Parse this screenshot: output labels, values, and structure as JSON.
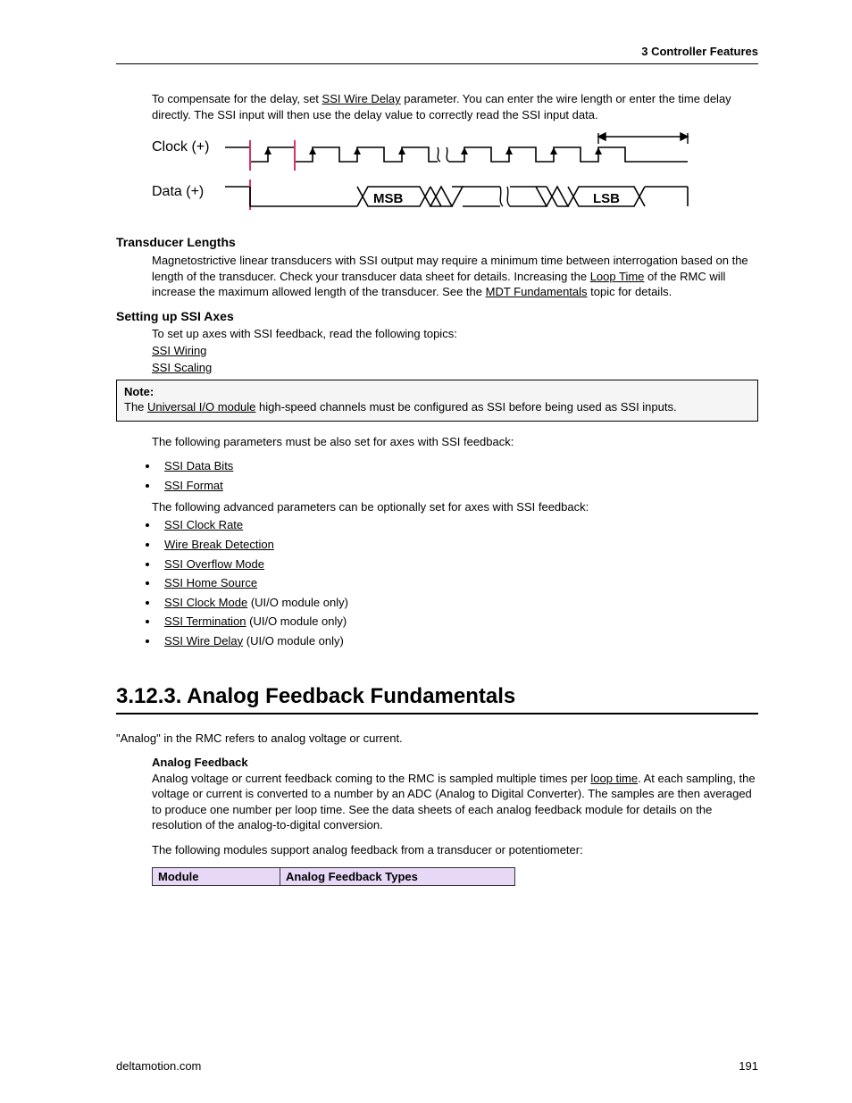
{
  "header": "3  Controller Features",
  "intro": {
    "pre": "To compensate for the delay, set ",
    "link": "SSI Wire Delay",
    "post": " parameter. You can enter the wire length or enter the time delay directly. The SSI input will then use the delay value to correctly read the SSI input data."
  },
  "diagram": {
    "clock_label": "Clock (+)",
    "data_label": "Data (+)",
    "msb": "MSB",
    "lsb": "LSB"
  },
  "transducer_lengths": {
    "heading": "Transducer Lengths",
    "p1_a": "Magnetostrictive linear transducers with SSI output may require a minimum time between interrogation based on the length of the transducer. Check your transducer data sheet for details. Increasing the ",
    "p1_link1": "Loop Time",
    "p1_b": " of the RMC will increase the maximum allowed length of the transducer. See the ",
    "p1_link2": "MDT Fundamentals",
    "p1_c": " topic for details."
  },
  "setup_ssi": {
    "heading": "Setting up SSI Axes",
    "p1": "To set up axes with SSI feedback, read the following topics:",
    "links": [
      "SSI Wiring",
      "SSI Scaling"
    ]
  },
  "note": {
    "label": "Note:",
    "a": "The ",
    "link": "Universal I/O module",
    "b": " high-speed channels must be configured as SSI before being used as SSI inputs."
  },
  "params": {
    "p1": "The following parameters must be also set for axes with SSI feedback:",
    "must": [
      "SSI Data Bits",
      "SSI Format"
    ],
    "p2": "The following advanced parameters can be optionally set for axes with SSI feedback:",
    "optional": [
      {
        "link": "SSI Clock Rate",
        "suffix": ""
      },
      {
        "link": "Wire Break Detection",
        "suffix": ""
      },
      {
        "link": "SSI Overflow Mode",
        "suffix": ""
      },
      {
        "link": "SSI Home Source",
        "suffix": ""
      },
      {
        "link": "SSI Clock Mode",
        "suffix": " (UI/O module only)"
      },
      {
        "link": "SSI Termination",
        "suffix": " (UI/O module only)"
      },
      {
        "link": "SSI Wire Delay",
        "suffix": " (UI/O module only)"
      }
    ]
  },
  "section": {
    "title": "3.12.3. Analog Feedback Fundamentals",
    "intro": "\"Analog\" in the RMC refers to analog voltage or current.",
    "subhead": "Analog Feedback",
    "p1_a": "Analog voltage or current feedback coming to the RMC is sampled multiple times per ",
    "p1_link": "loop time",
    "p1_b": ". At each sampling, the voltage or current is converted to a number by an ADC (Analog to Digital Converter). The samples are then averaged to produce one number per loop time. See the data sheets of each analog feedback module for details on the resolution of the analog-to-digital conversion.",
    "p2": "The following modules support analog feedback from a transducer or potentiometer:"
  },
  "table": {
    "col1": "Module",
    "col2": "Analog Feedback Types"
  },
  "footer": {
    "left": "deltamotion.com",
    "right": "191"
  }
}
